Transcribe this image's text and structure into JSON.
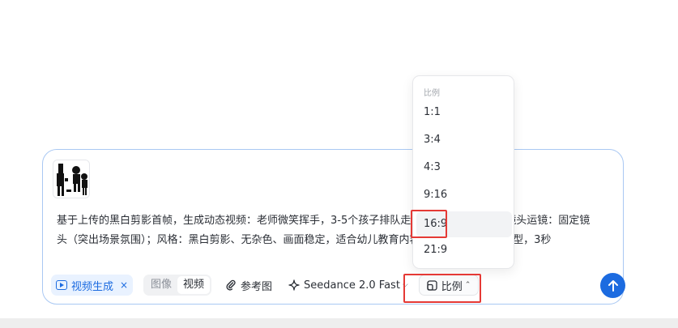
{
  "composer": {
    "prompt": "基于上传的黑白剪影首帧，生成动态视频：老师微笑挥手，3-5个孩子排队走入教室，动作舒缓；镜头运镜：固定镜头（突出场景氛围）；风格：黑白剪影、无杂色、画面稳定，适合幼儿教育内容，Seedance 2.0模型，3秒",
    "thumbnail_icon": "silhouette-image"
  },
  "toolbar": {
    "mode_chip_label": "视频生成",
    "mode_chip_close": "×",
    "segment_image": "图像",
    "segment_video": "视频",
    "reference_label": "参考图",
    "model_label": "Seedance 2.0 Fast",
    "ratio_label": "比例",
    "send_icon": "arrow-up-icon"
  },
  "ratio_menu": {
    "header": "比例",
    "items": [
      {
        "label": "1:1"
      },
      {
        "label": "3:4"
      },
      {
        "label": "4:3"
      },
      {
        "label": "9:16"
      },
      {
        "label": "16:9",
        "selected": true
      },
      {
        "label": "21:9"
      }
    ]
  },
  "colors": {
    "accent": "#1c6be0",
    "highlight": "#e53935"
  }
}
